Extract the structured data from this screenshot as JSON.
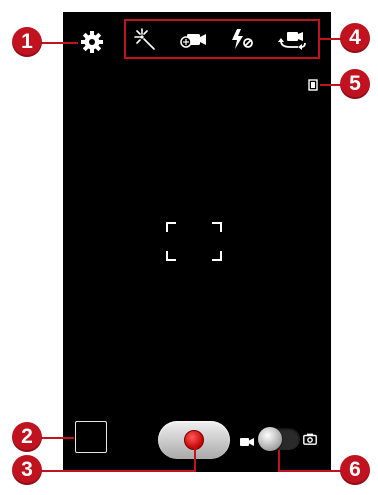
{
  "callouts": {
    "c1": "1",
    "c2": "2",
    "c3": "3",
    "c4": "4",
    "c5": "5",
    "c6": "6"
  },
  "icons": {
    "settings": "gear-icon",
    "effects": "sparkle-effects-icon",
    "recording_mode": "camcorder-mode-icon",
    "flash": "flash-off-icon",
    "switch_camera": "switch-camera-icon",
    "storage": "storage-memory-icon",
    "video_mode": "video-camera-icon",
    "photo_mode": "camera-icon"
  },
  "colors": {
    "callout": "#c1121f",
    "viewfinder": "#000000",
    "record": "#d00000",
    "icon": "#ffffff"
  },
  "mode_switch": {
    "selected": "video"
  }
}
